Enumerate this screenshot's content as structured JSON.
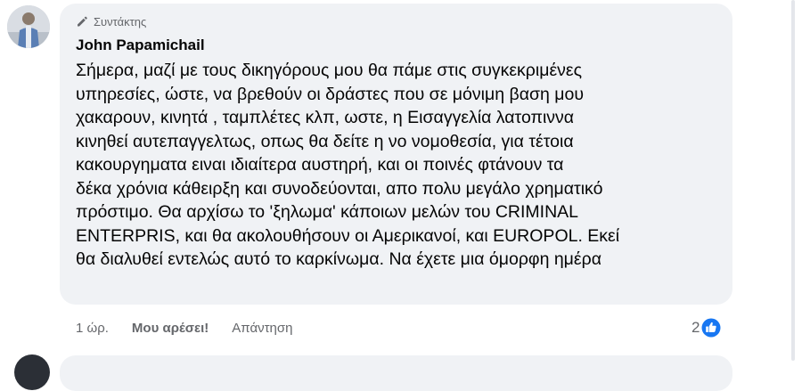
{
  "comment": {
    "badge_label": "Συντάκτης",
    "author": "John Papamichail",
    "lines": [
      "Σήμερα, μαζί με τους δικηγόρους μου θα πάμε στις συγκεκριμένες",
      "υπηρεσίες, ώστε, να βρεθούν οι δράστες που σε μόνιμη βαση μου",
      "χακαρουν, κινητά , ταμπλέτες κλπ, ωστε, η Εισαγγελία λατοπιννα",
      "κινηθεί αυτεπαγγελτως, οπως θα δείτε η νο νομοθεσία, για τέτοια",
      "κακουργηματα ειναι ιδιαίτερα αυστηρή, και οι ποινές φτάνουν τα",
      "δέκα χρόνια κάθειρξη και συνοδεύονται, απο πολυ μεγάλο χρηματικό",
      "πρόστιμο. Θα αρχίσω το 'ξηλωμα' κάποιων μελών του CRIMINAL",
      "ENTERPRIS, και θα ακολουθήσουν οι Αμερικανοί, και EUROPOL. Εκεί",
      "θα διαλυθεί εντελώς αυτό το καρκίνωμα. Να έχετε μια όμορφη ημέρα"
    ],
    "timestamp": "1 ώρ.",
    "like_label": "Μου αρέσει!",
    "reply_label": "Απάντηση",
    "reaction_count": "2",
    "icons": {
      "badge": "pencil-icon",
      "reaction": "thumbs-up-icon"
    },
    "colors": {
      "bubble": "#f0f2f5",
      "text": "#050505",
      "secondary": "#65676b",
      "like_blue": "#1877f2"
    }
  }
}
